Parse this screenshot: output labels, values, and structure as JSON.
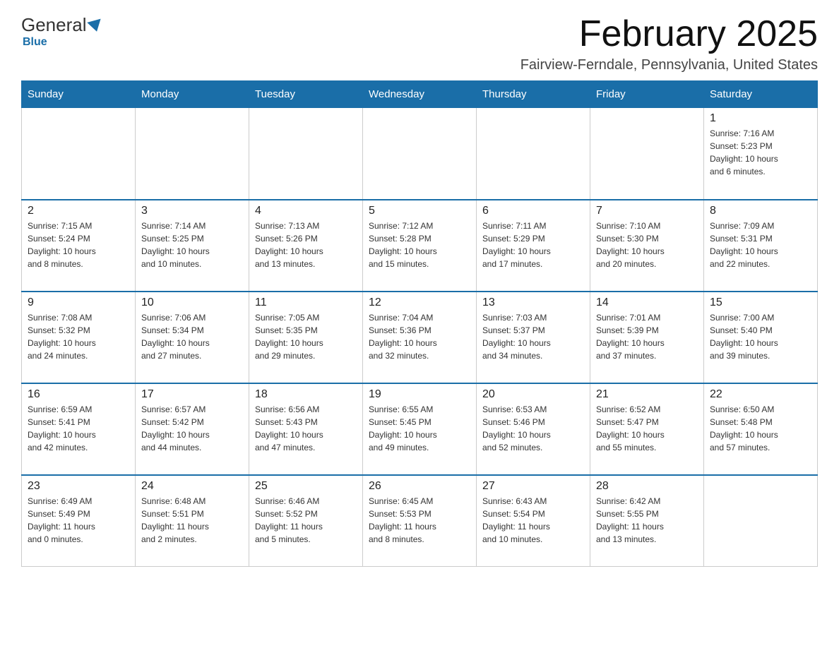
{
  "header": {
    "logo_general": "General",
    "logo_blue": "Blue",
    "month_title": "February 2025",
    "location": "Fairview-Ferndale, Pennsylvania, United States"
  },
  "weekdays": [
    "Sunday",
    "Monday",
    "Tuesday",
    "Wednesday",
    "Thursday",
    "Friday",
    "Saturday"
  ],
  "weeks": [
    [
      {
        "day": "",
        "info": []
      },
      {
        "day": "",
        "info": []
      },
      {
        "day": "",
        "info": []
      },
      {
        "day": "",
        "info": []
      },
      {
        "day": "",
        "info": []
      },
      {
        "day": "",
        "info": []
      },
      {
        "day": "1",
        "info": [
          "Sunrise: 7:16 AM",
          "Sunset: 5:23 PM",
          "Daylight: 10 hours",
          "and 6 minutes."
        ]
      }
    ],
    [
      {
        "day": "2",
        "info": [
          "Sunrise: 7:15 AM",
          "Sunset: 5:24 PM",
          "Daylight: 10 hours",
          "and 8 minutes."
        ]
      },
      {
        "day": "3",
        "info": [
          "Sunrise: 7:14 AM",
          "Sunset: 5:25 PM",
          "Daylight: 10 hours",
          "and 10 minutes."
        ]
      },
      {
        "day": "4",
        "info": [
          "Sunrise: 7:13 AM",
          "Sunset: 5:26 PM",
          "Daylight: 10 hours",
          "and 13 minutes."
        ]
      },
      {
        "day": "5",
        "info": [
          "Sunrise: 7:12 AM",
          "Sunset: 5:28 PM",
          "Daylight: 10 hours",
          "and 15 minutes."
        ]
      },
      {
        "day": "6",
        "info": [
          "Sunrise: 7:11 AM",
          "Sunset: 5:29 PM",
          "Daylight: 10 hours",
          "and 17 minutes."
        ]
      },
      {
        "day": "7",
        "info": [
          "Sunrise: 7:10 AM",
          "Sunset: 5:30 PM",
          "Daylight: 10 hours",
          "and 20 minutes."
        ]
      },
      {
        "day": "8",
        "info": [
          "Sunrise: 7:09 AM",
          "Sunset: 5:31 PM",
          "Daylight: 10 hours",
          "and 22 minutes."
        ]
      }
    ],
    [
      {
        "day": "9",
        "info": [
          "Sunrise: 7:08 AM",
          "Sunset: 5:32 PM",
          "Daylight: 10 hours",
          "and 24 minutes."
        ]
      },
      {
        "day": "10",
        "info": [
          "Sunrise: 7:06 AM",
          "Sunset: 5:34 PM",
          "Daylight: 10 hours",
          "and 27 minutes."
        ]
      },
      {
        "day": "11",
        "info": [
          "Sunrise: 7:05 AM",
          "Sunset: 5:35 PM",
          "Daylight: 10 hours",
          "and 29 minutes."
        ]
      },
      {
        "day": "12",
        "info": [
          "Sunrise: 7:04 AM",
          "Sunset: 5:36 PM",
          "Daylight: 10 hours",
          "and 32 minutes."
        ]
      },
      {
        "day": "13",
        "info": [
          "Sunrise: 7:03 AM",
          "Sunset: 5:37 PM",
          "Daylight: 10 hours",
          "and 34 minutes."
        ]
      },
      {
        "day": "14",
        "info": [
          "Sunrise: 7:01 AM",
          "Sunset: 5:39 PM",
          "Daylight: 10 hours",
          "and 37 minutes."
        ]
      },
      {
        "day": "15",
        "info": [
          "Sunrise: 7:00 AM",
          "Sunset: 5:40 PM",
          "Daylight: 10 hours",
          "and 39 minutes."
        ]
      }
    ],
    [
      {
        "day": "16",
        "info": [
          "Sunrise: 6:59 AM",
          "Sunset: 5:41 PM",
          "Daylight: 10 hours",
          "and 42 minutes."
        ]
      },
      {
        "day": "17",
        "info": [
          "Sunrise: 6:57 AM",
          "Sunset: 5:42 PM",
          "Daylight: 10 hours",
          "and 44 minutes."
        ]
      },
      {
        "day": "18",
        "info": [
          "Sunrise: 6:56 AM",
          "Sunset: 5:43 PM",
          "Daylight: 10 hours",
          "and 47 minutes."
        ]
      },
      {
        "day": "19",
        "info": [
          "Sunrise: 6:55 AM",
          "Sunset: 5:45 PM",
          "Daylight: 10 hours",
          "and 49 minutes."
        ]
      },
      {
        "day": "20",
        "info": [
          "Sunrise: 6:53 AM",
          "Sunset: 5:46 PM",
          "Daylight: 10 hours",
          "and 52 minutes."
        ]
      },
      {
        "day": "21",
        "info": [
          "Sunrise: 6:52 AM",
          "Sunset: 5:47 PM",
          "Daylight: 10 hours",
          "and 55 minutes."
        ]
      },
      {
        "day": "22",
        "info": [
          "Sunrise: 6:50 AM",
          "Sunset: 5:48 PM",
          "Daylight: 10 hours",
          "and 57 minutes."
        ]
      }
    ],
    [
      {
        "day": "23",
        "info": [
          "Sunrise: 6:49 AM",
          "Sunset: 5:49 PM",
          "Daylight: 11 hours",
          "and 0 minutes."
        ]
      },
      {
        "day": "24",
        "info": [
          "Sunrise: 6:48 AM",
          "Sunset: 5:51 PM",
          "Daylight: 11 hours",
          "and 2 minutes."
        ]
      },
      {
        "day": "25",
        "info": [
          "Sunrise: 6:46 AM",
          "Sunset: 5:52 PM",
          "Daylight: 11 hours",
          "and 5 minutes."
        ]
      },
      {
        "day": "26",
        "info": [
          "Sunrise: 6:45 AM",
          "Sunset: 5:53 PM",
          "Daylight: 11 hours",
          "and 8 minutes."
        ]
      },
      {
        "day": "27",
        "info": [
          "Sunrise: 6:43 AM",
          "Sunset: 5:54 PM",
          "Daylight: 11 hours",
          "and 10 minutes."
        ]
      },
      {
        "day": "28",
        "info": [
          "Sunrise: 6:42 AM",
          "Sunset: 5:55 PM",
          "Daylight: 11 hours",
          "and 13 minutes."
        ]
      },
      {
        "day": "",
        "info": []
      }
    ]
  ]
}
